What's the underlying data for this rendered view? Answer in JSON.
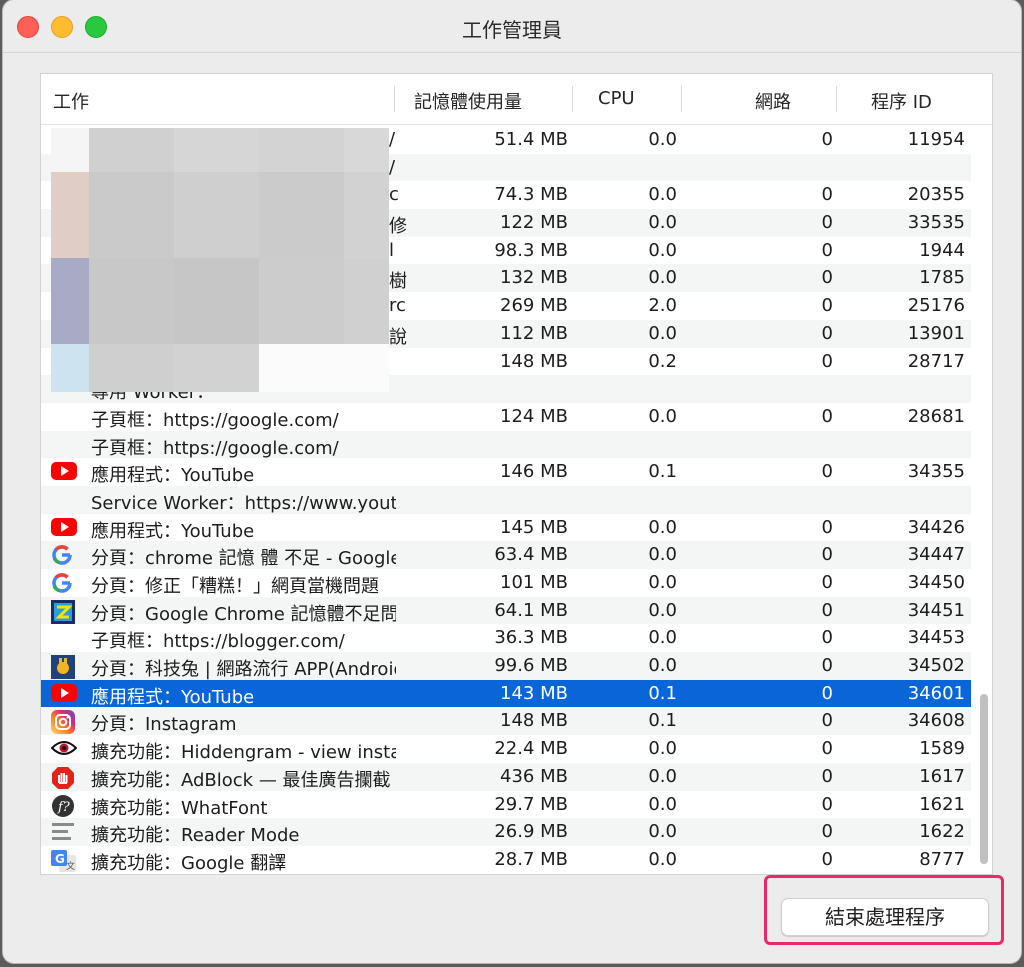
{
  "window": {
    "title": "工作管理員"
  },
  "columns": {
    "task": "工作",
    "memory": "記憶體使用量",
    "cpu": "CPU",
    "network": "網路",
    "pid": "程序 ID"
  },
  "rows": [
    {
      "name": "",
      "icon": "",
      "mem": "51.4 MB",
      "cpu": "0.0",
      "net": "0",
      "pid": "11954",
      "trail": "/"
    },
    {
      "name": "",
      "icon": "",
      "mem": "",
      "cpu": "",
      "net": "",
      "pid": "",
      "trail": "/"
    },
    {
      "name": "",
      "icon": "",
      "mem": "74.3 MB",
      "cpu": "0.0",
      "net": "0",
      "pid": "20355",
      "trail": "c"
    },
    {
      "name": "",
      "icon": "",
      "mem": "122 MB",
      "cpu": "0.0",
      "net": "0",
      "pid": "33535",
      "trail": "修"
    },
    {
      "name": "",
      "icon": "",
      "mem": "98.3 MB",
      "cpu": "0.0",
      "net": "0",
      "pid": "1944",
      "trail": "l"
    },
    {
      "name": "",
      "icon": "",
      "mem": "132 MB",
      "cpu": "0.0",
      "net": "0",
      "pid": "1785",
      "trail": "樹"
    },
    {
      "name": "",
      "icon": "",
      "mem": "269 MB",
      "cpu": "2.0",
      "net": "0",
      "pid": "25176",
      "trail": "rc"
    },
    {
      "name": "",
      "icon": "",
      "mem": "112 MB",
      "cpu": "0.0",
      "net": "0",
      "pid": "13901",
      "trail": "說"
    },
    {
      "name": "",
      "icon": "",
      "mem": "148 MB",
      "cpu": "0.2",
      "net": "0",
      "pid": "28717",
      "trail": ""
    },
    {
      "name": "專用 Worker：",
      "icon": "",
      "mem": "",
      "cpu": "",
      "net": "",
      "pid": "",
      "trail": ""
    },
    {
      "name": "子頁框：https://google.com/",
      "icon": "",
      "mem": "124 MB",
      "cpu": "0.0",
      "net": "0",
      "pid": "28681",
      "trail": ""
    },
    {
      "name": "子頁框：https://google.com/",
      "icon": "",
      "mem": "",
      "cpu": "",
      "net": "",
      "pid": "",
      "trail": ""
    },
    {
      "name": "應用程式：YouTube",
      "icon": "youtube-icon",
      "mem": "146 MB",
      "cpu": "0.1",
      "net": "0",
      "pid": "34355",
      "trail": ""
    },
    {
      "name": "Service Worker：https://www.youtube.com/",
      "icon": "",
      "mem": "",
      "cpu": "",
      "net": "",
      "pid": "",
      "trail": ""
    },
    {
      "name": "應用程式：YouTube",
      "icon": "youtube-icon",
      "mem": "145 MB",
      "cpu": "0.0",
      "net": "0",
      "pid": "34426",
      "trail": ""
    },
    {
      "name": "分頁：chrome 記憶 體 不足 - Google 搜尋",
      "icon": "google-icon",
      "mem": "63.4 MB",
      "cpu": "0.0",
      "net": "0",
      "pid": "34447",
      "trail": ""
    },
    {
      "name": "分頁：修正「糟糕！」網頁當機問題",
      "icon": "google-icon",
      "mem": "101 MB",
      "cpu": "0.0",
      "net": "0",
      "pid": "34450",
      "trail": ""
    },
    {
      "name": "分頁：Google Chrome 記憶體不足問題",
      "icon": "site-icon",
      "mem": "64.1 MB",
      "cpu": "0.0",
      "net": "0",
      "pid": "34451",
      "trail": ""
    },
    {
      "name": "子頁框：https://blogger.com/",
      "icon": "",
      "mem": "36.3 MB",
      "cpu": "0.0",
      "net": "0",
      "pid": "34453",
      "trail": ""
    },
    {
      "name": "分頁：科技兔 | 網路流行 APP(Android",
      "icon": "rabbit-icon",
      "mem": "99.6 MB",
      "cpu": "0.0",
      "net": "0",
      "pid": "34502",
      "trail": ""
    },
    {
      "name": "應用程式：YouTube",
      "icon": "youtube-icon",
      "mem": "143 MB",
      "cpu": "0.1",
      "net": "0",
      "pid": "34601",
      "trail": "",
      "selected": true
    },
    {
      "name": "分頁：Instagram",
      "icon": "instagram-icon",
      "mem": "148 MB",
      "cpu": "0.1",
      "net": "0",
      "pid": "34608",
      "trail": ""
    },
    {
      "name": "擴充功能：Hiddengram - view instagram",
      "icon": "eye-icon",
      "mem": "22.4 MB",
      "cpu": "0.0",
      "net": "0",
      "pid": "1589",
      "trail": ""
    },
    {
      "name": "擴充功能：AdBlock — 最佳廣告攔截",
      "icon": "adblock-icon",
      "mem": "436 MB",
      "cpu": "0.0",
      "net": "0",
      "pid": "1617",
      "trail": ""
    },
    {
      "name": "擴充功能：WhatFont",
      "icon": "whatfont-icon",
      "mem": "29.7 MB",
      "cpu": "0.0",
      "net": "0",
      "pid": "1621",
      "trail": ""
    },
    {
      "name": "擴充功能：Reader Mode",
      "icon": "reader-icon",
      "mem": "26.9 MB",
      "cpu": "0.0",
      "net": "0",
      "pid": "1622",
      "trail": ""
    },
    {
      "name": "擴充功能：Google 翻譯",
      "icon": "translate-icon",
      "mem": "28.7 MB",
      "cpu": "0.0",
      "net": "0",
      "pid": "8777",
      "trail": ""
    }
  ],
  "buttons": {
    "end_process": "結束處理程序"
  },
  "colors": {
    "selection": "#0a66d8",
    "highlight_box": "#e8296b",
    "youtube": "#ff0000"
  }
}
